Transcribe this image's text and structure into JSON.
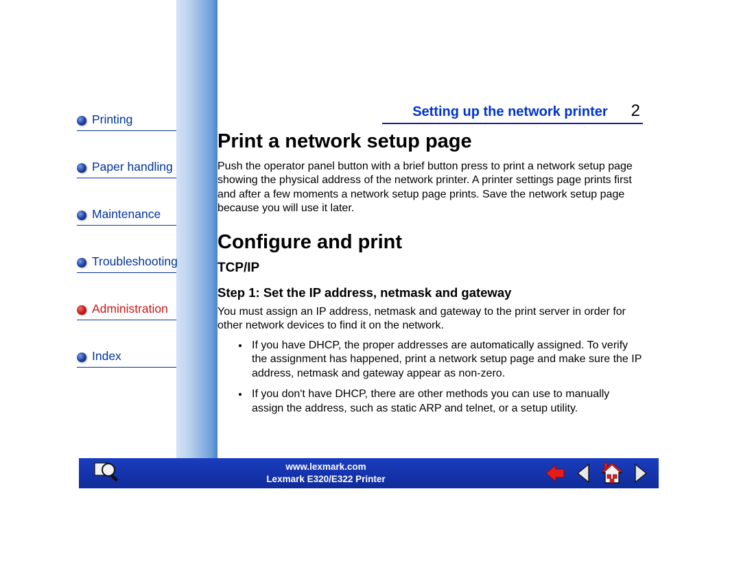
{
  "nav": {
    "items": [
      {
        "label": "Printing",
        "color": "blue"
      },
      {
        "label": "Paper handling",
        "color": "blue"
      },
      {
        "label": "Maintenance",
        "color": "blue"
      },
      {
        "label": "Troubleshooting",
        "color": "blue"
      },
      {
        "label": "Administration",
        "color": "red"
      },
      {
        "label": "Index",
        "color": "blue"
      }
    ]
  },
  "header": {
    "section": "Setting up the network printer",
    "page": "2"
  },
  "content": {
    "h1a": "Print a network setup page",
    "p1": "Push the operator panel button with a brief button press to print a network setup page showing the physical address of the network printer. A printer settings page prints first and after a few moments a network setup page prints. Save the network setup page because you will use it later.",
    "h1b": "Configure and print",
    "h3": "TCP/IP",
    "h4": "Step 1: Set the IP address, netmask and gateway",
    "p2": "You must assign an IP address, netmask and gateway to the print server in order for other network devices to find it on the network.",
    "li1": "If you have DHCP, the proper addresses are automatically assigned. To verify the assignment has happened, print a network setup page and make sure the IP address, netmask and gateway appear as non-zero.",
    "li2": "If you don't have DHCP, there are other methods you can use to manually assign the address, such as static ARP and telnet, or a setup utility."
  },
  "footer": {
    "url": "www.lexmark.com",
    "product": "Lexmark E320/E322 Printer"
  }
}
